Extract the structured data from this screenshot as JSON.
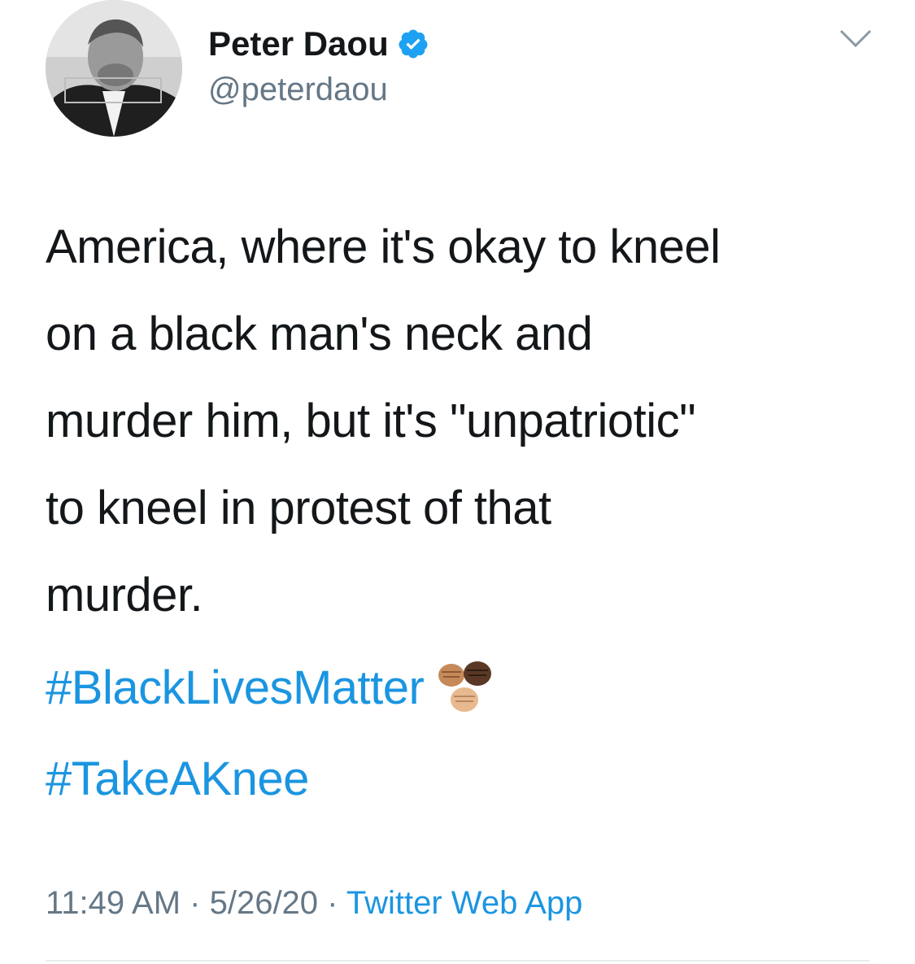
{
  "tweet": {
    "author": {
      "display_name": "Peter Daou",
      "handle": "@peterdaou",
      "verified": true
    },
    "text": "America, where it's okay to kneel\non a black man's neck and\nmurder him, but it's \"unpatriotic\"\nto kneel in protest of that\nmurder.",
    "hashtags": [
      "#BlackLivesMatter",
      "#TakeAKnee"
    ],
    "emoji": "raised-fist-multiple-skin-tones",
    "time": "11:49 AM",
    "separator": " · ",
    "date": "5/26/20",
    "source": "Twitter Web App"
  },
  "colors": {
    "text": "#14171a",
    "secondary": "#657786",
    "link": "#1b95e0",
    "verified": "#1da1f2"
  }
}
